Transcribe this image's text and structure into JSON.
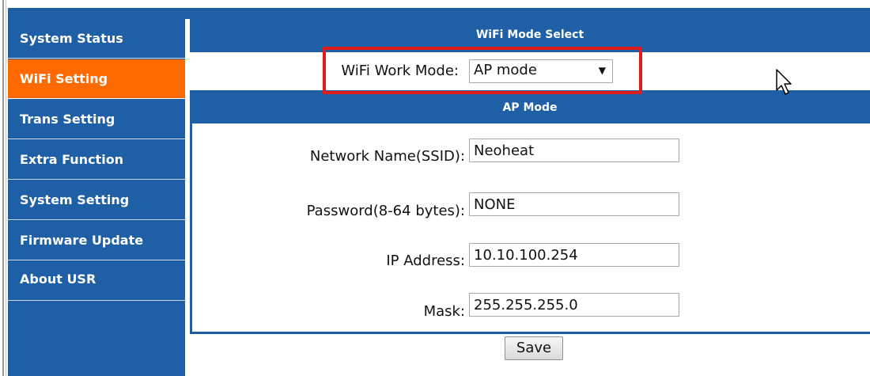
{
  "sidebar": {
    "items": [
      {
        "label": "System Status"
      },
      {
        "label": "WiFi Setting",
        "active": true
      },
      {
        "label": "Trans Setting"
      },
      {
        "label": "Extra Function"
      },
      {
        "label": "System Setting"
      },
      {
        "label": "Firmware Update"
      },
      {
        "label": "About USR"
      }
    ]
  },
  "mode_section": {
    "title": "WiFi Mode Select",
    "work_mode_label": "WiFi Work Mode:",
    "work_mode_value": "AP mode"
  },
  "ap_section": {
    "title": "AP Mode",
    "fields": [
      {
        "label": "Network Name(SSID):",
        "value": "Neoheat"
      },
      {
        "label": "Password(8-64 bytes):",
        "value": "NONE"
      },
      {
        "label": "IP Address:",
        "value": "10.10.100.254"
      },
      {
        "label": "Mask:",
        "value": "255.255.255.0"
      }
    ]
  },
  "actions": {
    "save_label": "Save"
  },
  "colors": {
    "nav_blue": "#1f5fa6",
    "active_orange": "#ff6a00",
    "highlight_red": "#e01b1b"
  }
}
